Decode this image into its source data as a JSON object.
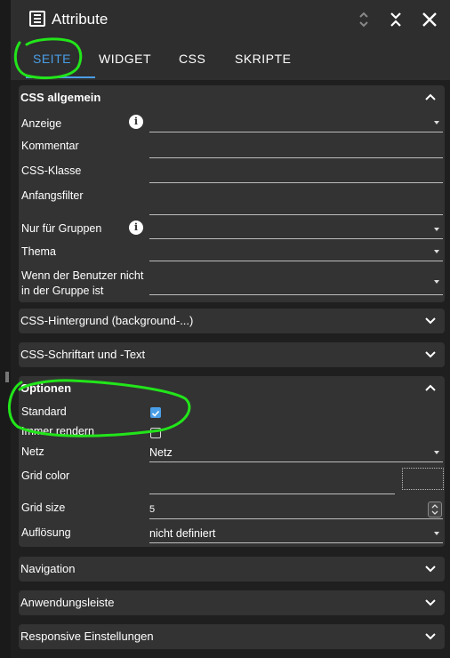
{
  "window": {
    "title": "Attribute",
    "icon": "attribute-list-icon",
    "buttons": [
      {
        "name": "sort-updown-icon",
        "glyph": "⇕"
      },
      {
        "name": "collapse-icon",
        "glyph": "⨯"
      },
      {
        "name": "close-icon",
        "glyph": "✕"
      }
    ]
  },
  "tabs": [
    "SEITE",
    "WIDGET",
    "CSS",
    "SKRIPTE"
  ],
  "active_tab": "SEITE",
  "sections": {
    "css_general": {
      "title": "CSS allgemein",
      "rows": {
        "anzeige": "Anzeige",
        "kommentar": "Kommentar",
        "css_klasse": "CSS-Klasse",
        "anfangsfilter": "Anfangsfilter",
        "nur_fuer_gruppen": "Nur für Gruppen",
        "thema": "Thema",
        "wenn_line1": "Wenn der Benutzer nicht",
        "wenn_line2": "in der Gruppe ist"
      }
    },
    "css_background": {
      "title": "CSS-Hintergrund (background-...)"
    },
    "css_font": {
      "title": "CSS-Schriftart und -Text"
    },
    "options": {
      "title": "Optionen",
      "rows": {
        "standard": "Standard",
        "standard_checked": true,
        "immer_rendern": "Immer rendern",
        "immer_rendern_checked": false,
        "netz": "Netz",
        "netz_value": "Netz",
        "grid_color": "Grid color",
        "grid_size": "Grid size",
        "grid_size_value": "5",
        "aufloesung": "Auflösung",
        "aufloesung_value": "nicht definiert"
      }
    },
    "navigation": {
      "title": "Navigation"
    },
    "anwendungsleiste": {
      "title": "Anwendungsleiste"
    },
    "responsive": {
      "title": "Responsive Einstellungen"
    }
  },
  "colors": {
    "accent": "#4a9ee8",
    "annotation": "#22e51a",
    "panel": "#333333",
    "background": "#1f1f1f"
  }
}
